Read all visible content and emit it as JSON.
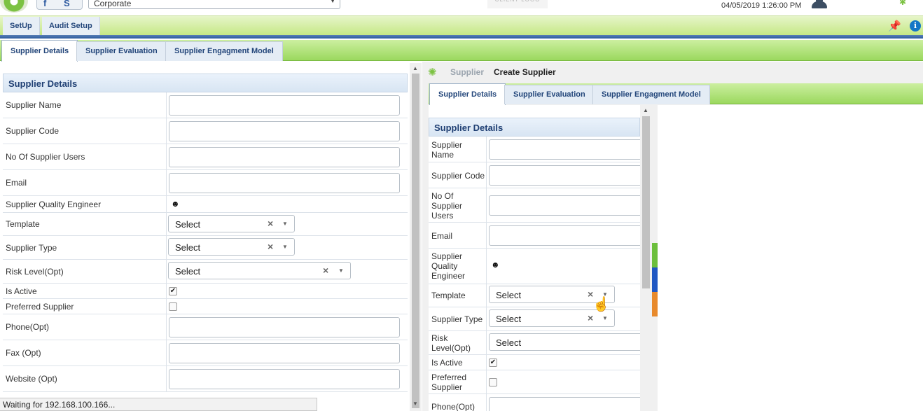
{
  "header": {
    "org_select": "Corporate",
    "client_logo": "CLIENT LOGO",
    "datetime": "04/05/2019 1:26:00 PM"
  },
  "menu": {
    "items": [
      "SetUp",
      "Audit Setup"
    ]
  },
  "tabs": [
    "Supplier Details",
    "Supplier Evaluation",
    "Supplier Engagment Model"
  ],
  "left_form": {
    "section_title": "Supplier Details",
    "fields": {
      "supplier_name": "Supplier Name",
      "supplier_code": "Supplier Code",
      "no_of_users": "No Of Supplier Users",
      "email": "Email",
      "sqe": "Supplier Quality Engineer",
      "template": "Template",
      "supplier_type": "Supplier Type",
      "risk_level": "Risk Level(Opt)",
      "is_active": "Is Active",
      "preferred": "Preferred Supplier",
      "phone": "Phone(Opt)",
      "fax": "Fax (Opt)",
      "website": "Website (Opt)"
    },
    "select_placeholder": "Select",
    "is_active_checked": true,
    "preferred_checked": false
  },
  "right_panel": {
    "breadcrumb": {
      "parent": "Supplier",
      "current": "Create Supplier"
    },
    "section_title": "Supplier Details",
    "fields": {
      "supplier_name": "Supplier Name",
      "supplier_code": "Supplier Code",
      "no_of_users": "No Of Supplier Users",
      "email": "Email",
      "sqe": "Supplier Quality Engineer",
      "template": "Template",
      "supplier_type": "Supplier Type",
      "risk_level": "Risk Level(Opt)",
      "is_active": "Is Active",
      "preferred": "Preferred Supplier",
      "phone": "Phone(Opt)"
    },
    "select_placeholder": "Select"
  },
  "status_bar": "Waiting for 192.168.100.166...",
  "icons": {
    "logo": "swirl-logo-icon",
    "facebook": "facebook-icon",
    "skype": "skype-icon",
    "user": "user-icon",
    "pin": "pin-icon",
    "info": "info-icon",
    "person_picker": "person-picker-icon",
    "clear": "clear-icon",
    "dropdown": "chevron-down-icon"
  },
  "colors": {
    "green_bar": "#9bd85e",
    "blue_line": "#2b5a9d",
    "header_text": "#1f3f73",
    "stripe_green": "#6cbf3c",
    "stripe_blue": "#1f57c3",
    "stripe_orange": "#e88a2c"
  }
}
